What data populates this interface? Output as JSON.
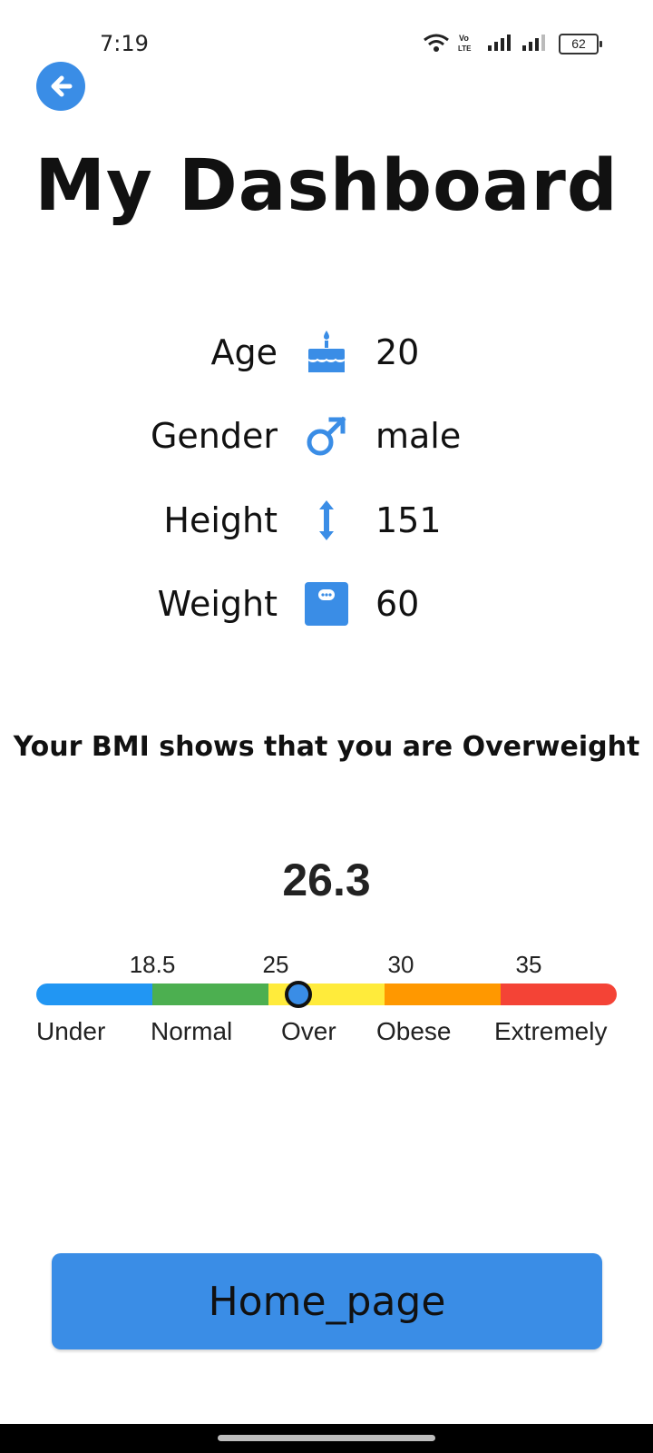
{
  "status_bar": {
    "time": "7:19",
    "battery": "62",
    "icons": [
      "wifi-icon",
      "volte-icon",
      "signal-icon",
      "signal-icon"
    ]
  },
  "back_button": {
    "icon": "arrow-left-icon"
  },
  "title": "My Dashboard",
  "profile": [
    {
      "label": "Age",
      "icon": "cake-icon",
      "value": "20"
    },
    {
      "label": "Gender",
      "icon": "male-icon",
      "value": "male"
    },
    {
      "label": "Height",
      "icon": "height-icon",
      "value": "151"
    },
    {
      "label": "Weight",
      "icon": "scale-icon",
      "value": "60"
    }
  ],
  "bmi": {
    "message": "Your BMI shows that you are Overweight",
    "value": "26.3",
    "thresholds": [
      "18.5",
      "25",
      "30",
      "35"
    ],
    "categories": [
      "Under",
      "Normal",
      "Over",
      "Obese",
      "Extremely"
    ],
    "colors": [
      "#2196f3",
      "#4caf50",
      "#ffeb3b",
      "#ff9800",
      "#f44336"
    ],
    "marker_value": 26.3
  },
  "home_button": "Home_page",
  "colors": {
    "accent": "#3a8de6"
  }
}
